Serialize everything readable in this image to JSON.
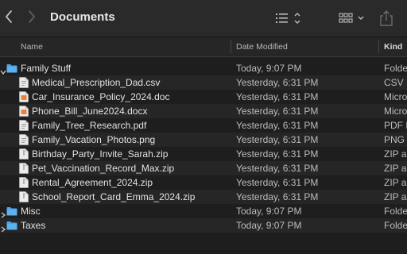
{
  "toolbar": {
    "title": "Documents",
    "back_icon": "chevron-left-icon",
    "forward_icon": "chevron-right-icon",
    "sort_icon": "list-sort-icon",
    "view_icon": "grid-view-icon",
    "share_icon": "share-icon"
  },
  "columns": {
    "name": "Name",
    "date": "Date Modified",
    "kind": "Kind"
  },
  "rows": [
    {
      "name": "Family Stuff",
      "date": "Today, 9:07 PM",
      "kind": "Folder",
      "type": "folder",
      "expanded": true
    },
    {
      "name": "Medical_Prescription_Dad.csv",
      "date": "Yesterday, 6:31 PM",
      "kind": "CSV Document",
      "type": "file"
    },
    {
      "name": "Car_Insurance_Policy_2024.doc",
      "date": "Yesterday, 6:31 PM",
      "kind": "Microsoft Word",
      "type": "file"
    },
    {
      "name": "Phone_Bill_June2024.docx",
      "date": "Yesterday, 6:31 PM",
      "kind": "Microsoft Word",
      "type": "file"
    },
    {
      "name": "Family_Tree_Research.pdf",
      "date": "Yesterday, 6:31 PM",
      "kind": "PDF Document",
      "type": "file"
    },
    {
      "name": "Family_Vacation_Photos.png",
      "date": "Yesterday, 6:31 PM",
      "kind": "PNG image",
      "type": "file"
    },
    {
      "name": "Birthday_Party_Invite_Sarah.zip",
      "date": "Yesterday, 6:31 PM",
      "kind": "ZIP archive",
      "type": "file"
    },
    {
      "name": "Pet_Vaccination_Record_Max.zip",
      "date": "Yesterday, 6:31 PM",
      "kind": "ZIP archive",
      "type": "file"
    },
    {
      "name": "Rental_Agreement_2024.zip",
      "date": "Yesterday, 6:31 PM",
      "kind": "ZIP archive",
      "type": "file"
    },
    {
      "name": "School_Report_Card_Emma_2024.zip",
      "date": "Yesterday, 6:31 PM",
      "kind": "ZIP archive",
      "type": "file"
    },
    {
      "name": "Misc",
      "date": "Today, 9:07 PM",
      "kind": "Folder",
      "type": "folder",
      "expanded": false
    },
    {
      "name": "Taxes",
      "date": "Today, 9:07 PM",
      "kind": "Folder",
      "type": "folder",
      "expanded": false
    }
  ],
  "colors": {
    "folder": "#4aa3e8",
    "accent_orange": "#e9823b"
  }
}
